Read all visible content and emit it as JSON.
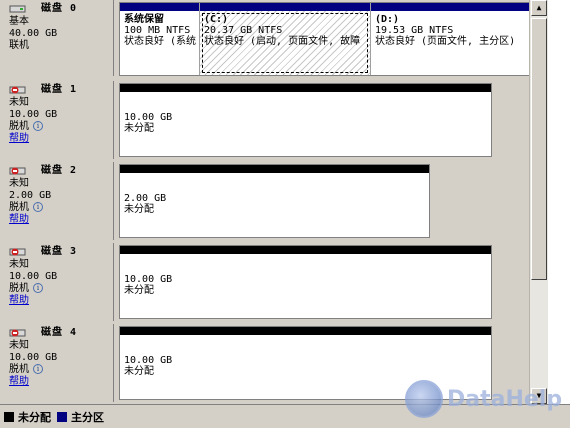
{
  "disks": [
    {
      "name": "磁盘 0",
      "type": "基本",
      "size": "40.00 GB",
      "status": "联机",
      "help": "",
      "partitions": [
        {
          "title": "系统保留",
          "size": "100 MB NTFS",
          "status": "状态良好 (系统"
        },
        {
          "title": "(C:)",
          "size": "20.37 GB NTFS",
          "status": "状态良好 (启动, 页面文件, 故障"
        },
        {
          "title": "(D:)",
          "size": "19.53 GB NTFS",
          "status": "状态良好 (页面文件, 主分区)"
        }
      ]
    },
    {
      "name": "磁盘 1",
      "type": "未知",
      "size": "10.00 GB",
      "status": "脱机",
      "help": "帮助",
      "partitions": [
        {
          "title": "",
          "size": "10.00 GB",
          "status": "未分配"
        }
      ]
    },
    {
      "name": "磁盘 2",
      "type": "未知",
      "size": "2.00 GB",
      "status": "脱机",
      "help": "帮助",
      "partitions": [
        {
          "title": "",
          "size": "2.00 GB",
          "status": "未分配"
        }
      ]
    },
    {
      "name": "磁盘 3",
      "type": "未知",
      "size": "10.00 GB",
      "status": "脱机",
      "help": "帮助",
      "partitions": [
        {
          "title": "",
          "size": "10.00 GB",
          "status": "未分配"
        }
      ]
    },
    {
      "name": "磁盘 4",
      "type": "未知",
      "size": "10.00 GB",
      "status": "脱机",
      "help": "帮助",
      "partitions": [
        {
          "title": "",
          "size": "10.00 GB",
          "status": "未分配"
        }
      ]
    }
  ],
  "legend": [
    {
      "label": "未分配",
      "color": "#000000"
    },
    {
      "label": "主分区",
      "color": "#000080"
    }
  ],
  "info_icon": "i",
  "watermark": "DataHelp"
}
